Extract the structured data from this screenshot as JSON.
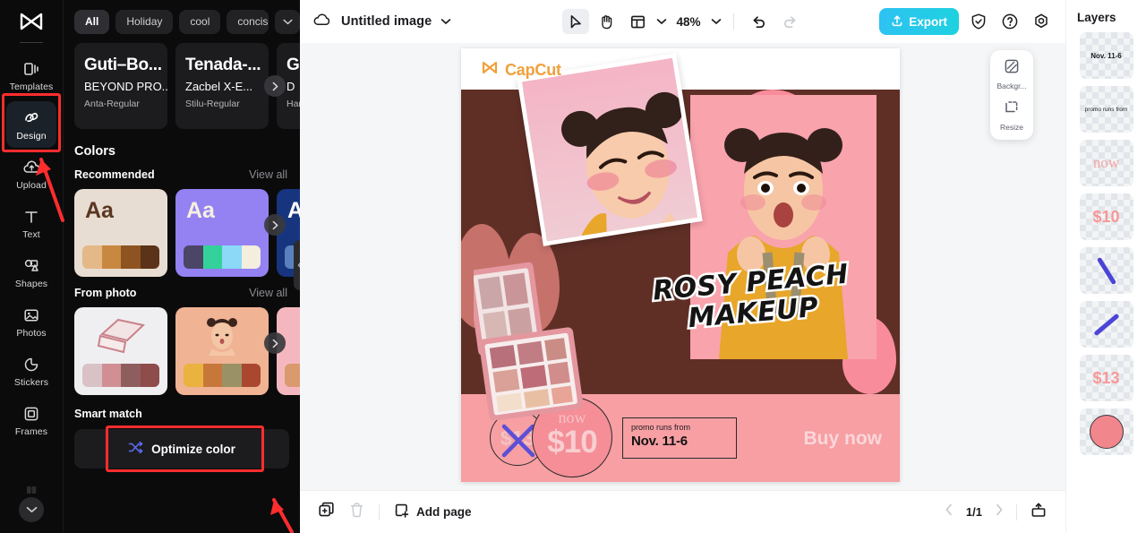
{
  "app": {
    "brand": "CapCut"
  },
  "rail": {
    "logo_icon": "capcut-logo-icon",
    "items": [
      {
        "label": "Templates",
        "icon": "templates-icon",
        "active": false
      },
      {
        "label": "Design",
        "icon": "design-icon",
        "active": true
      },
      {
        "label": "Upload",
        "icon": "upload-cloud-icon",
        "active": false
      },
      {
        "label": "Text",
        "icon": "text-icon",
        "active": false
      },
      {
        "label": "Shapes",
        "icon": "shapes-icon",
        "active": false
      },
      {
        "label": "Photos",
        "icon": "photos-icon",
        "active": false
      },
      {
        "label": "Stickers",
        "icon": "stickers-icon",
        "active": false
      },
      {
        "label": "Frames",
        "icon": "frames-icon",
        "active": false
      }
    ],
    "more_icon": "chevron-down-icon"
  },
  "panel": {
    "chips": [
      {
        "label": "All",
        "active": true
      },
      {
        "label": "Holiday",
        "active": false
      },
      {
        "label": "cool",
        "active": false
      },
      {
        "label": "concise",
        "active": false
      }
    ],
    "chips_more_icon": "chevron-down-icon",
    "fonts": [
      {
        "line1": "Guti–Bo...",
        "line2": "BEYOND PRO...",
        "line3": "Anta-Regular"
      },
      {
        "line1": "Tenada-...",
        "line2": "Zacbel X-E...",
        "line3": "Stilu-Regular"
      },
      {
        "line1": "Gl",
        "line2": "D",
        "line3": "Ham"
      }
    ],
    "colors_title": "Colors",
    "recommended": {
      "title": "Recommended",
      "view_all": "View all",
      "cards": [
        {
          "bg": "#e8ddd2",
          "aa": "Aa",
          "aa_color": "#5a3722",
          "swatches": [
            "#e4b887",
            "#c8883f",
            "#8d5421",
            "#5b3318"
          ]
        },
        {
          "bg": "#9481f2",
          "aa": "Aa",
          "aa_color": "#f6f0e0",
          "swatches": [
            "#4b4566",
            "#34d29a",
            "#8bd9f7",
            "#f3eedd"
          ]
        },
        {
          "bg": "#16357e",
          "aa": "A",
          "aa_color": "#ffffff",
          "swatches": [
            "#5a81bd",
            "#5a81bd",
            "#5a81bd",
            "#5a81bd"
          ]
        }
      ]
    },
    "from_photo": {
      "title": "From photo",
      "view_all": "View all",
      "cards": [
        {
          "bg": "#efeff1",
          "swatches": [
            "#d8c2c5",
            "#d18f94",
            "#8e5e5e",
            "#8e4c4a"
          ]
        },
        {
          "bg": "#f0b393",
          "swatches": [
            "#eab33f",
            "#c8773a",
            "#9a9166",
            "#a9482e"
          ]
        },
        {
          "bg": "#f5b7bf",
          "swatches": [
            "#d99a6e",
            "#d99a6e",
            "#d99a6e",
            "#d99a6e"
          ]
        }
      ]
    },
    "smart_match": {
      "title": "Smart match",
      "button_label": "Optimize color",
      "button_icon": "shuffle-icon"
    },
    "next_arrow_icon": "chevron-right-icon",
    "collapse_icon": "chevron-left-icon"
  },
  "topbar": {
    "cloud_icon": "cloud-saved-icon",
    "doc_title": "Untitled image",
    "title_caret_icon": "chevron-down-icon",
    "tools": [
      {
        "name": "select-tool",
        "icon": "cursor-arrow-icon",
        "selected": true
      },
      {
        "name": "hand-tool",
        "icon": "hand-icon",
        "selected": false
      },
      {
        "name": "layout-tool",
        "icon": "layout-panel-icon",
        "selected": false
      }
    ],
    "layout_caret_icon": "chevron-down-icon",
    "zoom_level": "48%",
    "zoom_caret_icon": "chevron-down-icon",
    "undo_icon": "undo-icon",
    "redo_icon": "redo-icon",
    "export_label": "Export",
    "export_icon": "upload-icon",
    "export_color": "#2ec2f2",
    "shield_icon": "shield-check-icon",
    "help_icon": "question-circle-icon",
    "settings_icon": "gear-icon"
  },
  "float_panel": [
    {
      "label": "Backgr...",
      "icon": "background-icon"
    },
    {
      "label": "Resize",
      "icon": "resize-icon"
    }
  ],
  "bottombar": {
    "duplicate_icon": "duplicate-page-icon",
    "delete_icon": "trash-icon",
    "add_page_label": "Add page",
    "add_page_icon": "add-page-icon",
    "prev_icon": "chevron-left-icon",
    "page_indicator": "1/1",
    "next_icon": "chevron-right-icon",
    "present_icon": "present-icon"
  },
  "layers": {
    "title": "Layers",
    "items": [
      {
        "name": "layer-text-nov",
        "kind": "text",
        "text": "Nov. 11-6",
        "style": "bold"
      },
      {
        "name": "layer-text-promo",
        "kind": "text",
        "text": "promo runs from",
        "style": "thin"
      },
      {
        "name": "layer-text-now",
        "kind": "now",
        "text": "now"
      },
      {
        "name": "layer-text-price-10",
        "kind": "price",
        "text": "$10"
      },
      {
        "name": "layer-shape-line-1",
        "kind": "line"
      },
      {
        "name": "layer-shape-line-2",
        "kind": "line"
      },
      {
        "name": "layer-text-price-13",
        "kind": "price",
        "text": "$13"
      },
      {
        "name": "layer-shape-circle",
        "kind": "circle"
      }
    ]
  },
  "poster": {
    "brand": "CapCut",
    "headline_line1": "ROSY PEACH",
    "headline_line2": "MAKEUP",
    "old_price": "$13",
    "now_label": "now",
    "new_price": "$10",
    "promo_small": "promo runs from",
    "promo_date": "Nov. 11-6",
    "cta": "Buy now",
    "colors": {
      "brown": "#5f2f26",
      "pink_band": "#f79fa3",
      "blob_pink": "#f98c9b",
      "brand_orange": "#f0a13c"
    }
  },
  "annotations": {
    "highlight_color": "#ff2d2d",
    "targets": [
      "design-rail-item",
      "optimize-color-button"
    ]
  }
}
